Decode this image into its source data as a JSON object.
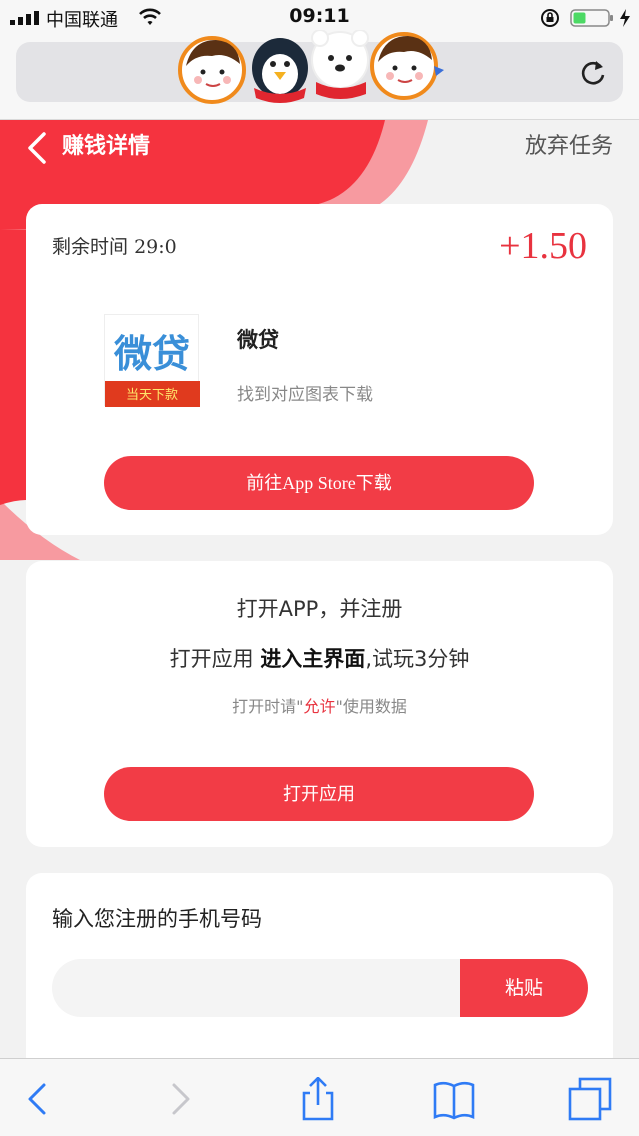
{
  "status": {
    "carrier": "中国联通",
    "time": "09:11"
  },
  "header": {
    "title": "赚钱详情",
    "abandon_label": "放弃任务"
  },
  "task": {
    "remain_label": "剩余时间",
    "remain_value": "29:0",
    "reward": "+1.50",
    "app_name": "微贷",
    "app_icon_text": "微贷",
    "app_icon_banner": "当天下款",
    "app_desc": "找到对应图表下载",
    "download_button": "前往App Store下载"
  },
  "step": {
    "line1": "打开APP，并注册",
    "line2_prefix": "打开应用 ",
    "line2_bold": "进入主界面",
    "line2_suffix": ",试玩3分钟",
    "line3_prefix": "打开时请\"",
    "line3_allow": "允许",
    "line3_suffix": "\"使用数据",
    "open_button": "打开应用"
  },
  "phone": {
    "label": "输入您注册的手机号码",
    "placeholder": "",
    "paste_button": "粘贴"
  },
  "colors": {
    "accent": "#f23c46",
    "header_red": "#f5333f"
  }
}
